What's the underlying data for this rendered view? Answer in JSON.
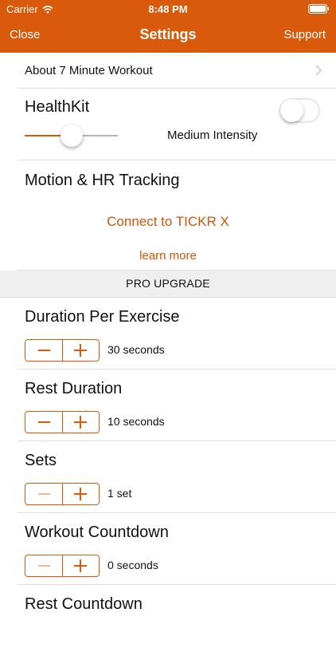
{
  "status_bar": {
    "carrier": "Carrier",
    "time": "8:48 PM",
    "wifi_icon": "wifi-icon",
    "battery_icon": "battery-icon"
  },
  "nav": {
    "close_label": "Close",
    "title": "Settings",
    "support_label": "Support"
  },
  "colors": {
    "accent": "#d95a0a",
    "section_header_bg": "#efefef",
    "separator": "#dedede"
  },
  "about": {
    "label": "About 7 Minute Workout",
    "chevron_icon": "chevron-right-icon"
  },
  "healthkit": {
    "label": "HealthKit",
    "toggle_on": false
  },
  "intensity": {
    "label": "Medium Intensity",
    "level": 0.5
  },
  "motion": {
    "label": "Motion & HR Tracking",
    "connect_label": "Connect to TICKR X",
    "learn_more_label": "learn more"
  },
  "pro_upgrade": {
    "header": "PRO UPGRADE",
    "settings": [
      {
        "label": "Duration Per Exercise",
        "value": "30 seconds",
        "minus_enabled": true
      },
      {
        "label": "Rest Duration",
        "value": "10 seconds",
        "minus_enabled": true
      },
      {
        "label": "Sets",
        "value": "1 set",
        "minus_enabled": false
      },
      {
        "label": "Workout Countdown",
        "value": "0 seconds",
        "minus_enabled": false
      },
      {
        "label": "Rest Countdown",
        "value": "",
        "minus_enabled": true
      }
    ]
  }
}
